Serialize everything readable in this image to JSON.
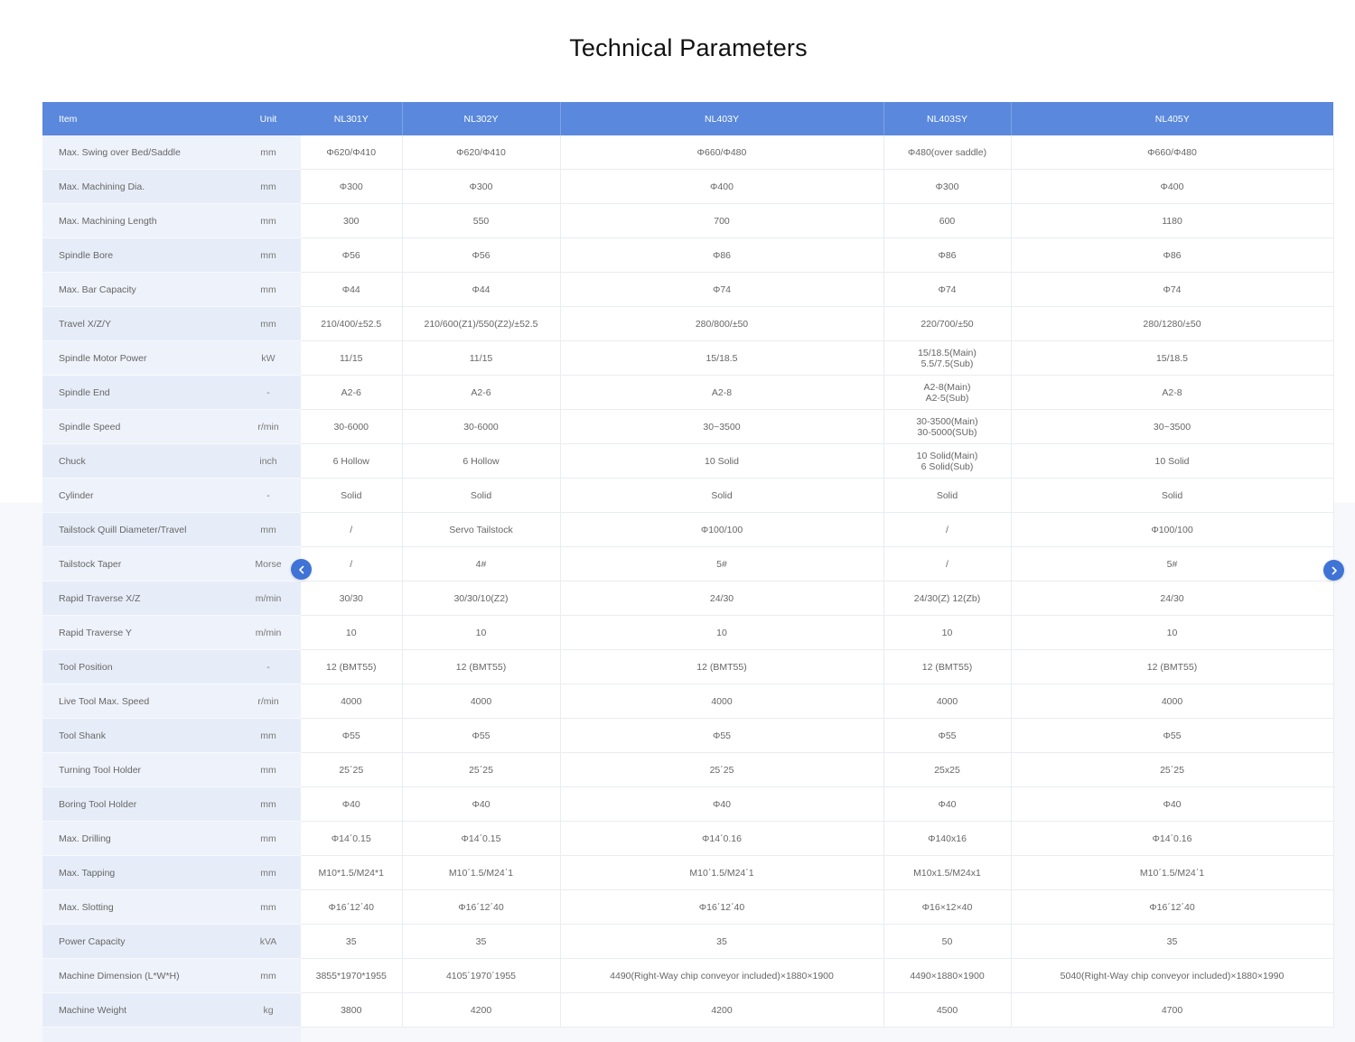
{
  "page": {
    "title": "Technical Parameters"
  },
  "table": {
    "headers": [
      "Item",
      "Unit",
      "NL301Y",
      "NL302Y",
      "NL403Y",
      "NL403SY",
      "NL405Y"
    ],
    "rows": [
      {
        "item": "Max. Swing over Bed/Saddle",
        "unit": "mm",
        "values": [
          "Φ620/Φ410",
          "Φ620/Φ410",
          "Φ660/Φ480",
          "Φ480(over   saddle)",
          "Φ660/Φ480"
        ]
      },
      {
        "item": "Max. Machining Dia.",
        "unit": "mm",
        "values": [
          "Φ300",
          "Φ300",
          "Φ400",
          "Φ300",
          "Φ400"
        ]
      },
      {
        "item": "Max. Machining Length",
        "unit": "mm",
        "values": [
          "300",
          "550",
          "700",
          "600",
          "1180"
        ]
      },
      {
        "item": "Spindle Bore",
        "unit": "mm",
        "values": [
          "Φ56",
          "Φ56",
          "Φ86",
          "Φ86",
          "Φ86"
        ]
      },
      {
        "item": "Max. Bar Capacity",
        "unit": "mm",
        "values": [
          "Φ44",
          "Φ44",
          "Φ74",
          "Φ74",
          "Φ74"
        ]
      },
      {
        "item": "Travel X/Z/Y",
        "unit": "mm",
        "values": [
          "210/400/±52.5",
          "210/600(Z1)/550(Z2)/±52.5",
          "280/800/±50",
          "220/700/±50",
          "280/1280/±50"
        ]
      },
      {
        "item": "Spindle Motor Power",
        "unit": "kW",
        "values": [
          "11/15",
          "11/15",
          "15/18.5",
          "15/18.5(Main)\n5.5/7.5(Sub)",
          "15/18.5"
        ]
      },
      {
        "item": "Spindle End",
        "unit": "-",
        "values": [
          "A2-6",
          "A2-6",
          "A2-8",
          "A2-8(Main)\nA2-5(Sub)",
          "A2-8"
        ]
      },
      {
        "item": "Spindle Speed",
        "unit": "r/min",
        "values": [
          "30-6000",
          "30-6000",
          "30~3500",
          "30-3500(Main)\n30-5000(SUb)",
          "30~3500"
        ]
      },
      {
        "item": "Chuck",
        "unit": "inch",
        "values": [
          "6   Hollow",
          "6   Hollow",
          "10   Solid",
          "10   Solid(Main)\n6 Solid(Sub)",
          "10   Solid"
        ]
      },
      {
        "item": "Cylinder",
        "unit": "-",
        "values": [
          "Solid",
          "Solid",
          "Solid",
          "Solid",
          "Solid"
        ]
      },
      {
        "item": "Tailstock Quill Diameter/Travel",
        "unit": "mm",
        "values": [
          "/",
          "Servo   Tailstock",
          "Φ100/100",
          "/",
          "Φ100/100"
        ]
      },
      {
        "item": "Tailstock Taper",
        "unit": "Morse",
        "values": [
          "/",
          "4#",
          "5#",
          "/",
          "5#"
        ]
      },
      {
        "item": "Rapid Traverse X/Z",
        "unit": "m/min",
        "values": [
          "30/30",
          "30/30/10(Z2)",
          "24/30",
          "24/30(Z)   12(Zb)",
          "24/30"
        ]
      },
      {
        "item": "Rapid Traverse Y",
        "unit": "m/min",
        "values": [
          "10",
          "10",
          "10",
          "10",
          "10"
        ]
      },
      {
        "item": "Tool Position",
        "unit": "-",
        "values": [
          "12   (BMT55)",
          "12   (BMT55)",
          "12   (BMT55)",
          "12   (BMT55)",
          "12   (BMT55)"
        ]
      },
      {
        "item": "Live Tool Max. Speed",
        "unit": "r/min",
        "values": [
          "4000",
          "4000",
          "4000",
          "4000",
          "4000"
        ]
      },
      {
        "item": "Tool Shank",
        "unit": "mm",
        "values": [
          "Φ55",
          "Φ55",
          "Φ55",
          "Φ55",
          "Φ55"
        ]
      },
      {
        "item": "Turning Tool Holder",
        "unit": "mm",
        "values": [
          "25΄25",
          "25΄25",
          "25΄25",
          "25x25",
          "25΄25"
        ]
      },
      {
        "item": "Boring Tool Holder",
        "unit": "mm",
        "values": [
          "Φ40",
          "Φ40",
          "Φ40",
          "Φ40",
          "Φ40"
        ]
      },
      {
        "item": "Max. Drilling",
        "unit": "mm",
        "values": [
          "Φ14΄0.15",
          "Φ14΄0.15",
          "Φ14΄0.16",
          "Φ140x16",
          "Φ14΄0.16"
        ]
      },
      {
        "item": "Max. Tapping",
        "unit": "mm",
        "values": [
          "M10*1.5/M24*1",
          "M10΄1.5/M24΄1",
          "M10΄1.5/M24΄1",
          "M10x1.5/M24x1",
          "M10΄1.5/M24΄1"
        ]
      },
      {
        "item": "Max. Slotting",
        "unit": "mm",
        "values": [
          "Φ16΄12΄40",
          "Φ16΄12΄40",
          "Φ16΄12΄40",
          "Φ16×12×40",
          "Φ16΄12΄40"
        ]
      },
      {
        "item": "Power Capacity",
        "unit": "kVA",
        "values": [
          "35",
          "35",
          "35",
          "50",
          "35"
        ]
      },
      {
        "item": "Machine Dimension (L*W*H)",
        "unit": "mm",
        "values": [
          "3855*1970*1955",
          "4105΄1970΄1955",
          "4490(Right-Way   chip conveyor included)×1880×1900",
          "4490×1880×1900",
          "5040(Right-Way   chip conveyor included)×1880×1990"
        ]
      },
      {
        "item": "Machine Weight",
        "unit": "kg",
        "values": [
          "3800",
          "4200",
          "4200",
          "4500",
          "4700"
        ]
      }
    ]
  },
  "nav": {
    "prev_icon": "chevron-left-icon",
    "next_icon": "chevron-right-icon",
    "color": "#3f73d6"
  },
  "colors": {
    "header_bg": "#5a88dc",
    "header_text": "#ffffff",
    "label_col_bg": "#eef2fa"
  }
}
